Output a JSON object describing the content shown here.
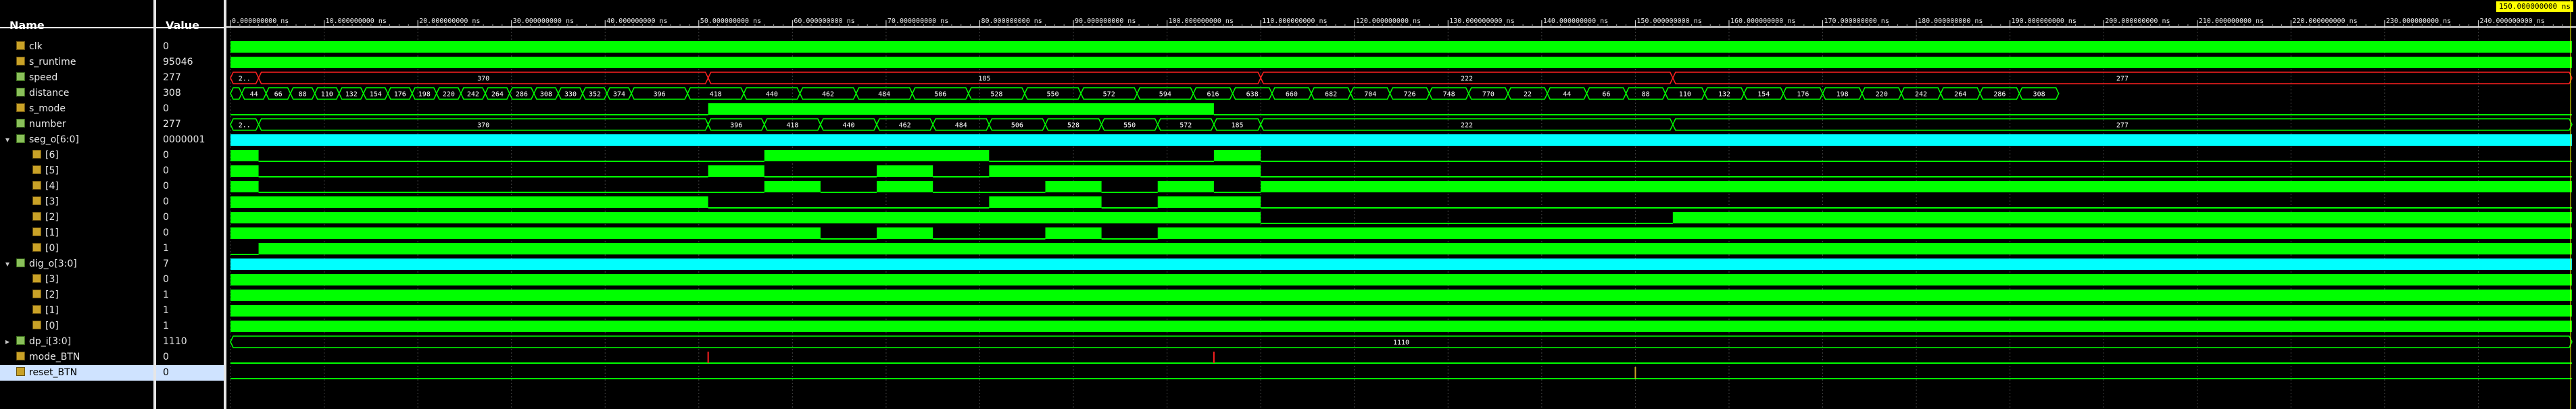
{
  "header": {
    "name_label": "Name",
    "value_label": "Value"
  },
  "cursor_time": "150.000000000 ns",
  "signals": [
    {
      "name": "clk",
      "value": "0",
      "kind": "bit",
      "child": false
    },
    {
      "name": "s_runtime",
      "value": "95046",
      "kind": "bit",
      "child": false
    },
    {
      "name": "speed",
      "value": "277",
      "kind": "bus",
      "child": false
    },
    {
      "name": "distance",
      "value": "308",
      "kind": "bus",
      "child": false
    },
    {
      "name": "s_mode",
      "value": "0",
      "kind": "bit",
      "child": false
    },
    {
      "name": "number",
      "value": "277",
      "kind": "bus",
      "child": false
    },
    {
      "name": "seg_o[6:0]",
      "value": "0000001",
      "kind": "bus",
      "child": false,
      "expander": "true"
    },
    {
      "name": "[6]",
      "value": "0",
      "kind": "bit",
      "child": true
    },
    {
      "name": "[5]",
      "value": "0",
      "kind": "bit",
      "child": true
    },
    {
      "name": "[4]",
      "value": "0",
      "kind": "bit",
      "child": true
    },
    {
      "name": "[3]",
      "value": "0",
      "kind": "bit",
      "child": true
    },
    {
      "name": "[2]",
      "value": "0",
      "kind": "bit",
      "child": true
    },
    {
      "name": "[1]",
      "value": "0",
      "kind": "bit",
      "child": true
    },
    {
      "name": "[0]",
      "value": "1",
      "kind": "bit",
      "child": true
    },
    {
      "name": "dig_o[3:0]",
      "value": "7",
      "kind": "bus",
      "child": false,
      "expander": "true"
    },
    {
      "name": "[3]",
      "value": "0",
      "kind": "bit",
      "child": true
    },
    {
      "name": "[2]",
      "value": "1",
      "kind": "bit",
      "child": true
    },
    {
      "name": "[1]",
      "value": "1",
      "kind": "bit",
      "child": true
    },
    {
      "name": "[0]",
      "value": "1",
      "kind": "bit",
      "child": true
    },
    {
      "name": "dp_i[3:0]",
      "value": "1110",
      "kind": "bus",
      "child": false,
      "expander": "false"
    },
    {
      "name": "mode_BTN",
      "value": "0",
      "kind": "bit",
      "child": false
    },
    {
      "name": "reset_BTN",
      "value": "0",
      "kind": "bit",
      "child": false,
      "selected": true
    }
  ],
  "time_ticks": [
    "0.000000000 ns",
    "10.000000000 ns",
    "20.000000000 ns",
    "30.000000000 ns",
    "40.000000000 ns",
    "50.000000000 ns",
    "60.000000000 ns",
    "70.000000000 ns",
    "80.000000000 ns",
    "90.000000000 ns",
    "100.000000000 ns",
    "110.000000000 ns",
    "120.000000000 ns",
    "130.000000000 ns",
    "140.000000000 ns",
    "150.000000000 ns",
    "160.000000000 ns",
    "170.000000000 ns",
    "180.000000000 ns",
    "190.000000000 ns",
    "200.000000000 ns",
    "210.000000000 ns",
    "220.000000000 ns",
    "230.000000000 ns",
    "240.000000000 ns"
  ],
  "bus_labels": {
    "speed": [
      "2..",
      "370",
      "185",
      "222",
      "277"
    ],
    "distance": [
      "22",
      "44",
      "66",
      "88",
      "110",
      "132",
      "154",
      "176",
      "198",
      "220",
      "242",
      "264",
      "286",
      "308",
      "330",
      "352",
      "374",
      "396",
      "418",
      "440",
      "462",
      "484",
      "506",
      "528",
      "550",
      "572",
      "594",
      "616",
      "638",
      "660",
      "682",
      "704",
      "726",
      "748",
      "770",
      "22",
      "44",
      "66",
      "88",
      "110",
      "132",
      "154",
      "176",
      "198",
      "220",
      "242",
      "264",
      "286",
      "308"
    ],
    "number": [
      "2..",
      "370",
      "396",
      "418",
      "440",
      "462",
      "484",
      "506",
      "528",
      "550",
      "572",
      "185",
      "222",
      "277"
    ],
    "dp": [
      "1110"
    ]
  },
  "colors": {
    "wave": "#00ff00",
    "bus_fill": "#00c800",
    "cyan": "#00ffff",
    "red": "#ff2020",
    "grid": "#404040"
  }
}
